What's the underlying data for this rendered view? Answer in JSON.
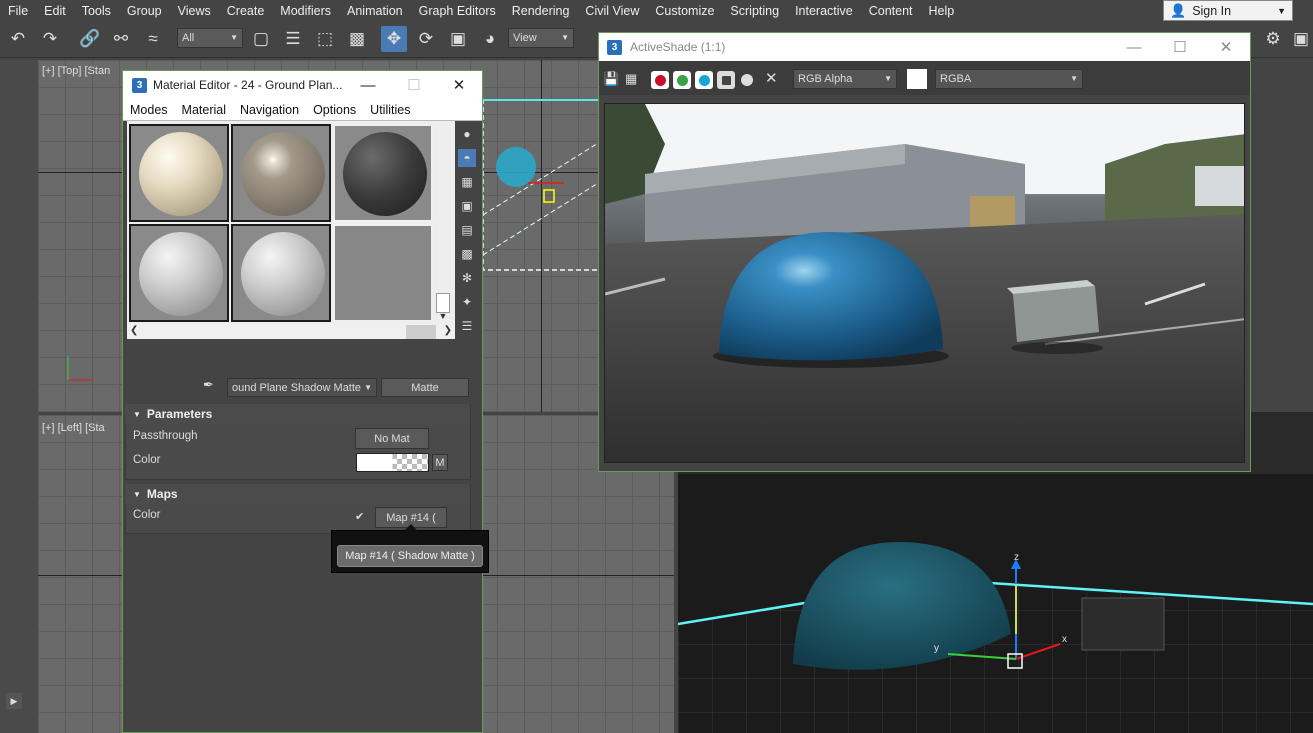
{
  "menubar": {
    "items": [
      "File",
      "Edit",
      "Tools",
      "Group",
      "Views",
      "Create",
      "Modifiers",
      "Animation",
      "Graph Editors",
      "Rendering",
      "Civil View",
      "Customize",
      "Scripting",
      "Interactive",
      "Content",
      "Help"
    ],
    "sign_in": "Sign In"
  },
  "toolbar": {
    "selection_filter": "All",
    "ref_coord": "View"
  },
  "viewports": {
    "top_label": "[+] [Top] [Stan",
    "left_label": "[+] [Left] [Sta"
  },
  "material_editor": {
    "title": "Material Editor - 24 - Ground Plan...",
    "menu": [
      "Modes",
      "Material",
      "Navigation",
      "Options",
      "Utilities"
    ],
    "material_name": "ound Plane Shadow Matte",
    "material_type": "Matte",
    "parameters": {
      "header": "Parameters",
      "passthrough_label": "Passthrough",
      "passthrough_button": "No Mat",
      "color_label": "Color",
      "color_map_button": "M"
    },
    "maps": {
      "header": "Maps",
      "color_label": "Color",
      "map_button": "Map #14 (",
      "tooltip": "Map #14 ( Shadow Matte )"
    }
  },
  "activeshade": {
    "title": "ActiveShade (1:1)",
    "channel_dropdown": "RGB Alpha",
    "display_dropdown": "RGBA",
    "accent_colors": [
      "#c8102e",
      "#3aa34a",
      "#17a6d8"
    ]
  },
  "perspective_axis": {
    "x": "x",
    "y": "y",
    "z": "z"
  }
}
